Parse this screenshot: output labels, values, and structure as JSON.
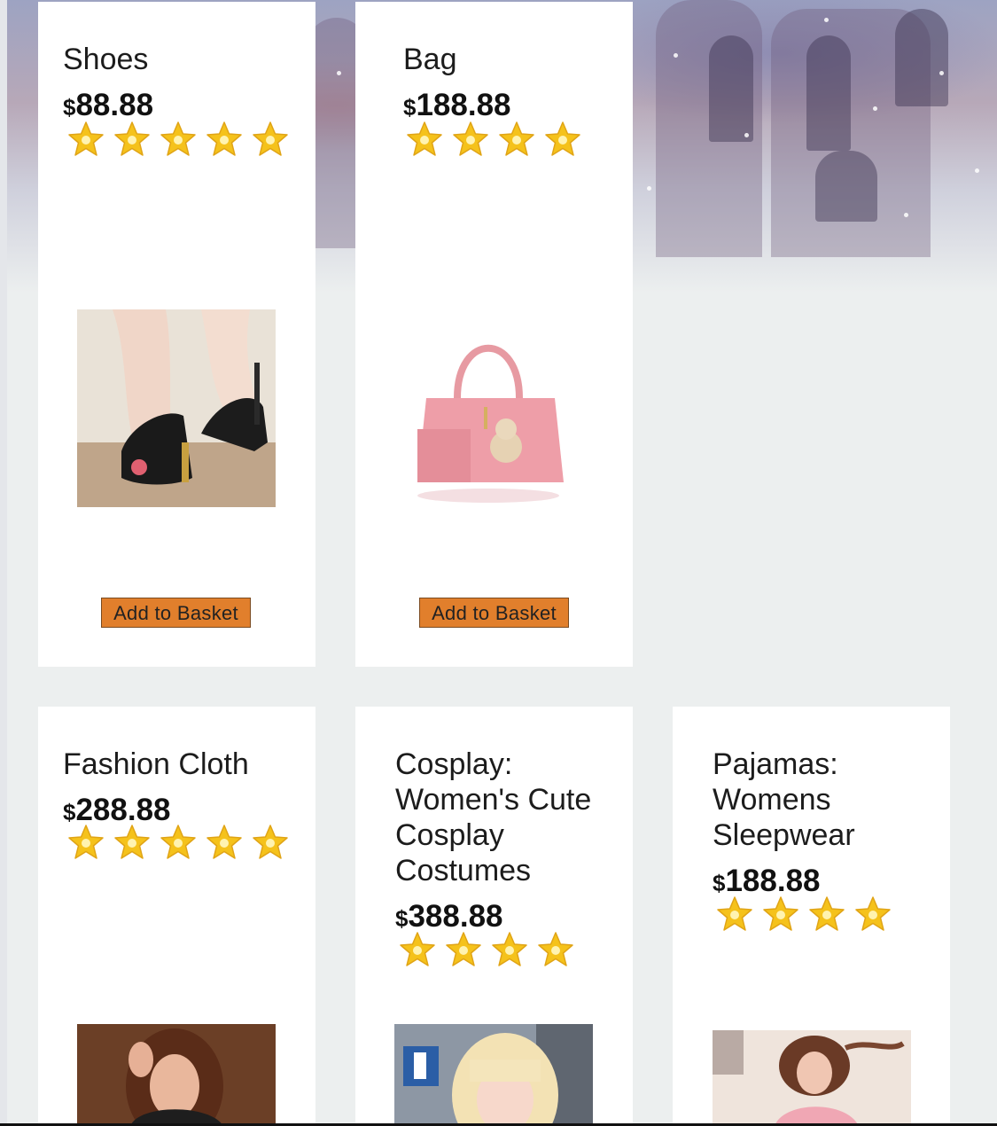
{
  "products": [
    {
      "name": "Shoes",
      "currency": "$",
      "price": "88.88",
      "rating": 5,
      "photo": "shoes",
      "button": "Add to Basket"
    },
    {
      "name": "Bag",
      "currency": "$",
      "price": "188.88",
      "rating": 4,
      "photo": "bag",
      "button": "Add to Basket"
    },
    {
      "name": "Fashion Cloth",
      "currency": "$",
      "price": "288.88",
      "rating": 5,
      "photo": "fashion-cloth"
    },
    {
      "name": "Cosplay: Women's Cute Cosplay Costumes",
      "currency": "$",
      "price": "388.88",
      "rating": 4,
      "photo": "cosplay"
    },
    {
      "name": "Pajamas: Womens Sleepwear",
      "currency": "$",
      "price": "188.88",
      "rating": 4,
      "photo": "pajamas"
    }
  ],
  "colors": {
    "button": "#e17f2c",
    "card": "#ffffff",
    "page": "#ecefef",
    "star": "#f5c21b"
  },
  "icons": {
    "star": "star-icon"
  }
}
